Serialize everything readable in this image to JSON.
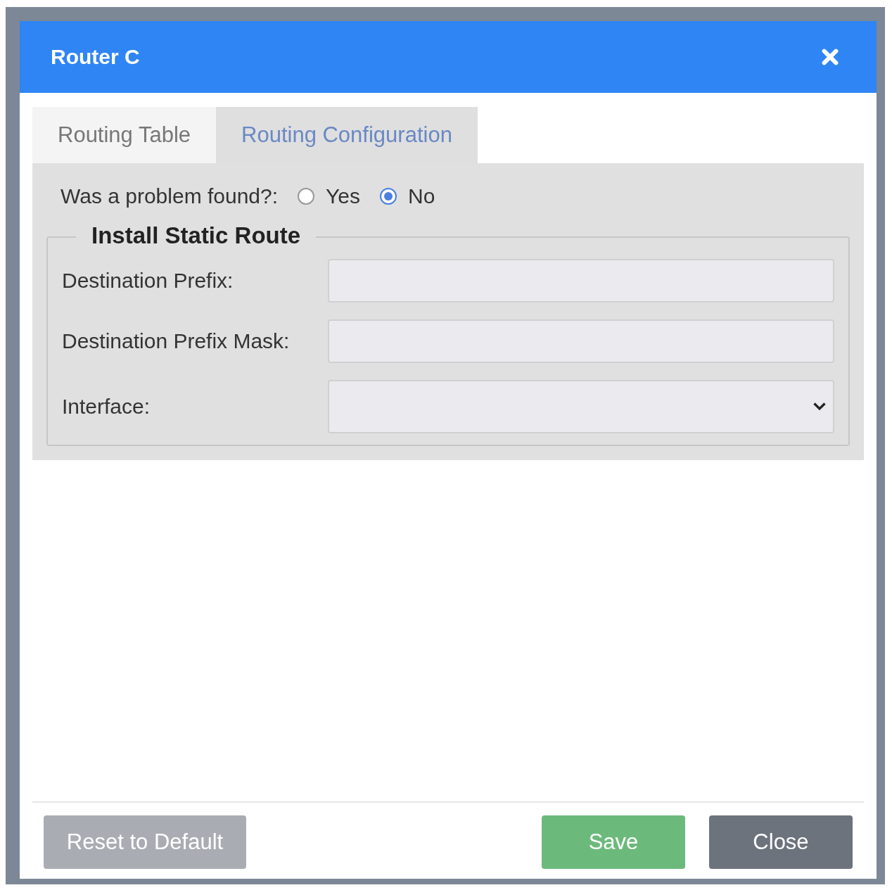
{
  "window": {
    "title": "Router C"
  },
  "tabs": [
    {
      "label": "Routing Table",
      "selected": false
    },
    {
      "label": "Routing Configuration",
      "selected": true
    }
  ],
  "question": {
    "label": "Was a problem found?:",
    "options": [
      {
        "label": "Yes",
        "selected": false
      },
      {
        "label": "No",
        "selected": true
      }
    ]
  },
  "fieldset": {
    "legend": "Install Static Route",
    "fields": [
      {
        "label": "Destination Prefix:",
        "kind": "text"
      },
      {
        "label": "Destination Prefix Mask:",
        "kind": "text"
      },
      {
        "label": "Interface:",
        "kind": "select"
      }
    ]
  },
  "buttons": [
    {
      "label": "Reset to Default",
      "kind": "reset"
    },
    {
      "label": "Save",
      "kind": "save"
    },
    {
      "label": "Close",
      "kind": "close"
    }
  ]
}
